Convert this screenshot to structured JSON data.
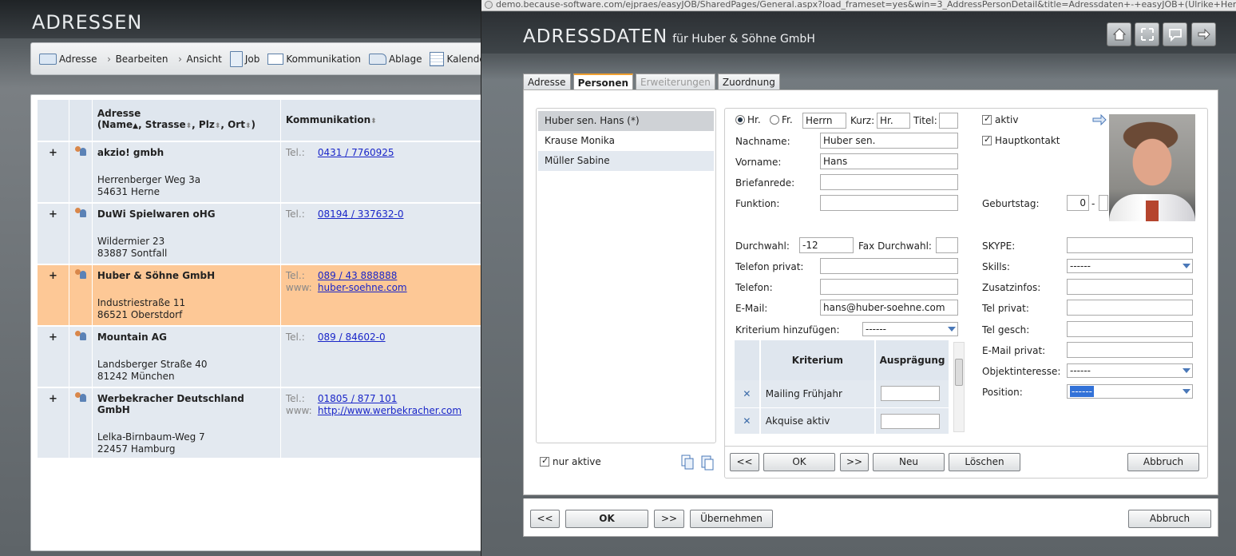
{
  "main": {
    "title": "ADRESSEN",
    "toolbar": [
      {
        "icon": "address-card-icon",
        "label": "Adresse"
      },
      {
        "icon": "chevron-right-icon",
        "label": "Bearbeiten"
      },
      {
        "icon": "chevron-right-icon",
        "label": "Ansicht"
      },
      {
        "icon": "document-icon",
        "label": "Job"
      },
      {
        "icon": "envelope-icon",
        "label": "Kommunikation"
      },
      {
        "icon": "folder-icon",
        "label": "Ablage"
      },
      {
        "icon": "calendar-icon",
        "label": "Kalender"
      }
    ],
    "table": {
      "header_addr_title": "Adresse",
      "header_addr_sort": "(Name",
      "header_strasse": ", Strasse",
      "header_plz": ", Plz",
      "header_ort": ", Ort",
      "header_close": ")",
      "header_comm": "Kommunikation",
      "tel_label": "Tel.:",
      "www_label": "www:",
      "plus": "+",
      "rows": [
        {
          "name": "akzio! gmbh",
          "street": "Herrenberger Weg 3a",
          "city": "54631 Herne",
          "tel": "0431 / 7760925",
          "www": ""
        },
        {
          "name": "DuWi Spielwaren oHG",
          "street": "Wildermier 23",
          "city": "83887 Sontfall",
          "tel": "08194 / 337632-0",
          "www": ""
        },
        {
          "name": "Huber & Söhne GmbH",
          "street": "Industriestraße 11",
          "city": "86521 Oberstdorf",
          "tel": "089 / 43 888888",
          "www": "huber-soehne.com"
        },
        {
          "name": "Mountain AG",
          "street": "Landsberger Straße 40",
          "city": "81242 München",
          "tel": "089 / 84602-0",
          "www": ""
        },
        {
          "name": "Werbekracher Deutschland GmbH",
          "street": "Lelka-Birnbaum-Weg 7",
          "city": "22457 Hamburg",
          "tel": "01805 / 877 101",
          "www": "http://www.werbekracher.com"
        }
      ]
    }
  },
  "popup": {
    "url": "demo.because-software.com/ejpraes/easyJOB/SharedPages/General.aspx?load_frameset=yes&win=3_AddressPersonDetail&title=Adressdaten+-+easyJOB+(Ulrike+Henme",
    "title": "ADRESSDATEN",
    "subtitle": "für Huber & Söhne GmbH",
    "header_buttons": [
      "home-icon",
      "fullscreen-icon",
      "comment-icon",
      "exit-icon"
    ],
    "tabs": [
      {
        "label": "Adresse",
        "state": "normal"
      },
      {
        "label": "Personen",
        "state": "active"
      },
      {
        "label": "Erweiterungen",
        "state": "disabled"
      },
      {
        "label": "Zuordnung",
        "state": "normal"
      }
    ],
    "persons": [
      "Huber sen. Hans (*)",
      "Krause Monika",
      "Müller Sabine"
    ],
    "only_active_label": "nur aktive",
    "form": {
      "hr_label": "Hr.",
      "fr_label": "Fr.",
      "anrede_value": "Herrn",
      "kurz_label": "Kurz:",
      "kurz_value": "Hr.",
      "titel_label": "Titel:",
      "titel_value": "",
      "aktiv_label": "aktiv",
      "hauptkontakt_label": "Hauptkontakt",
      "nachname_label": "Nachname:",
      "nachname_value": "Huber sen.",
      "vorname_label": "Vorname:",
      "vorname_value": "Hans",
      "briefanrede_label": "Briefanrede:",
      "briefanrede_value": "",
      "funktion_label": "Funktion:",
      "funktion_value": "",
      "geburtstag_label": "Geburtstag:",
      "geburtstag_day": "0",
      "geburtstag_sep": "-",
      "durchwahl_label": "Durchwahl:",
      "durchwahl_value": "-12",
      "fax_label": "Fax Durchwahl:",
      "fax_value": "",
      "telprivat_label": "Telefon privat:",
      "telprivat_value": "",
      "telefon_label": "Telefon:",
      "telefon_value": "",
      "email_label": "E-Mail:",
      "email_value": "hans@huber-soehne.com",
      "kriterium_label": "Kriterium hinzufügen:",
      "kriterium_value": "------",
      "skype_label": "SKYPE:",
      "skills_label": "Skills:",
      "skills_value": "------",
      "zusatz_label": "Zusatzinfos:",
      "telprivat2_label": "Tel privat:",
      "telgesch_label": "Tel gesch:",
      "emailprivat_label": "E-Mail privat:",
      "objekt_label": "Objektinteresse:",
      "objekt_value": "------",
      "position_label": "Position:",
      "position_value": "------"
    },
    "criteria": {
      "col_kriterium": "Kriterium",
      "col_auspraegung": "Ausprägung",
      "rows": [
        {
          "name": "Mailing Frühjahr",
          "value": ""
        },
        {
          "name": "Akquise aktiv",
          "value": ""
        }
      ]
    },
    "inner_buttons": {
      "prev": "<<",
      "ok": "OK",
      "next": ">>",
      "neu": "Neu",
      "loeschen": "Löschen",
      "abbruch": "Abbruch"
    },
    "outer_buttons": {
      "prev": "<<",
      "ok": "OK",
      "next": ">>",
      "uebernehmen": "Übernehmen",
      "abbruch": "Abbruch"
    }
  }
}
